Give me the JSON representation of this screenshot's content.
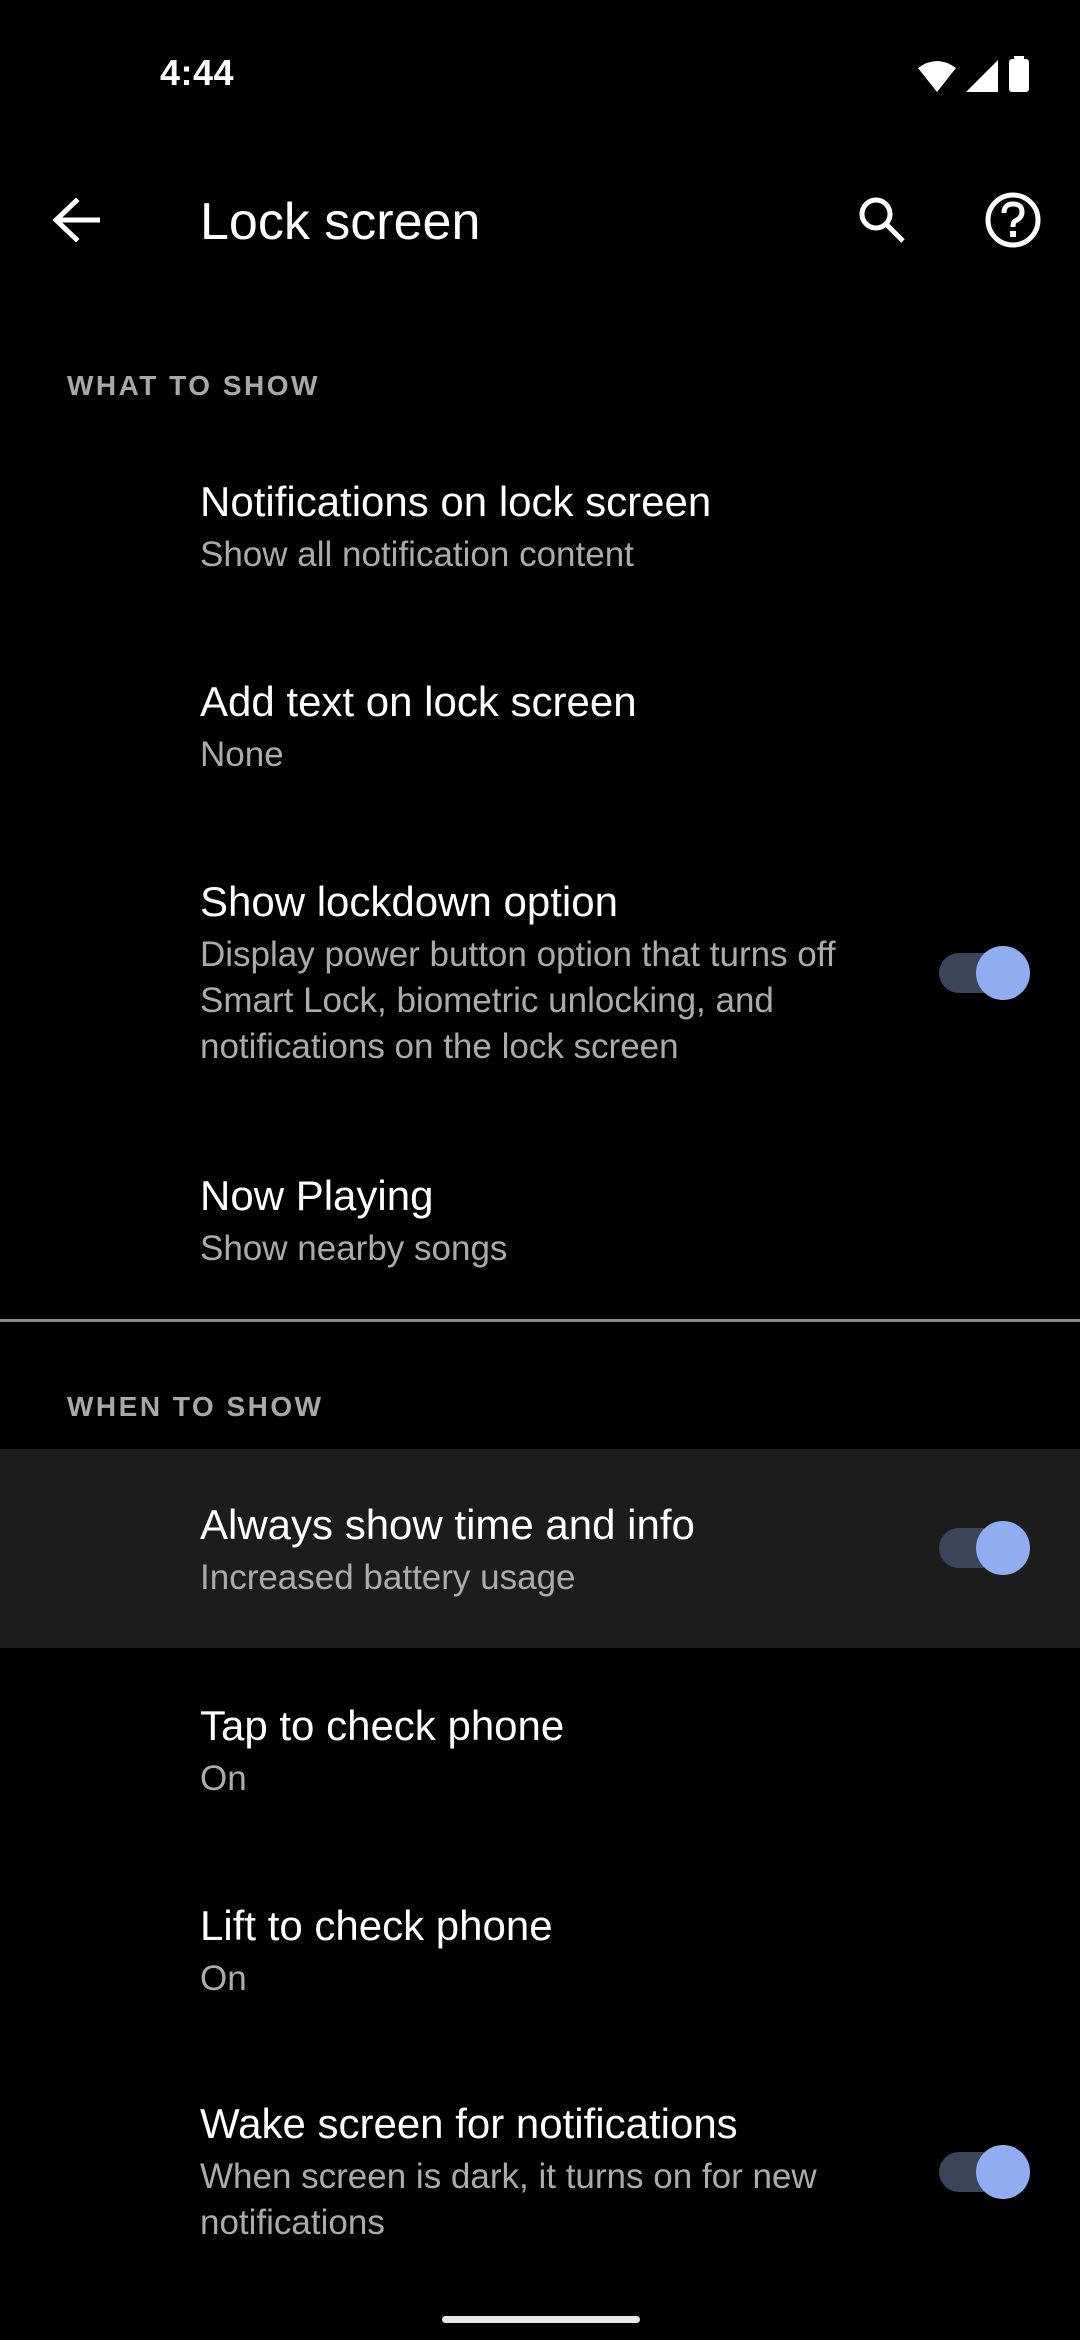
{
  "status_bar": {
    "time": "4:44",
    "icons": [
      "wifi-icon",
      "cell-signal-icon",
      "battery-icon"
    ]
  },
  "app_bar": {
    "title": "Lock screen",
    "back_icon": "arrow-back-icon",
    "actions": [
      "search-icon",
      "help-icon"
    ]
  },
  "sections": [
    {
      "header": "WHAT TO SHOW",
      "items": [
        {
          "title": "Notifications on lock screen",
          "summary": "Show all notification content"
        },
        {
          "title": "Add text on lock screen",
          "summary": "None"
        },
        {
          "title": "Show lockdown option",
          "summary": "Display power button option that turns off Smart Lock, biometric unlocking, and notifications on the lock screen",
          "toggle": true,
          "checked": true
        },
        {
          "title": "Now Playing",
          "summary": "Show nearby songs"
        }
      ]
    },
    {
      "header": "WHEN TO SHOW",
      "items": [
        {
          "title": "Always show time and info",
          "summary": "Increased battery usage",
          "toggle": true,
          "checked": true,
          "highlighted": true
        },
        {
          "title": "Tap to check phone",
          "summary": "On"
        },
        {
          "title": "Lift to check phone",
          "summary": "On"
        },
        {
          "title": "Wake screen for notifications",
          "summary": "When screen is dark, it turns on for new notifications",
          "toggle": true,
          "checked": true
        }
      ]
    }
  ],
  "colors": {
    "background": "#000000",
    "highlight_row": "#1c1c1c",
    "toggle_thumb_on": "#8fadf0",
    "toggle_track_on": "#3a4558",
    "secondary_text": "#ababab",
    "divider": "#8a8a8a"
  }
}
